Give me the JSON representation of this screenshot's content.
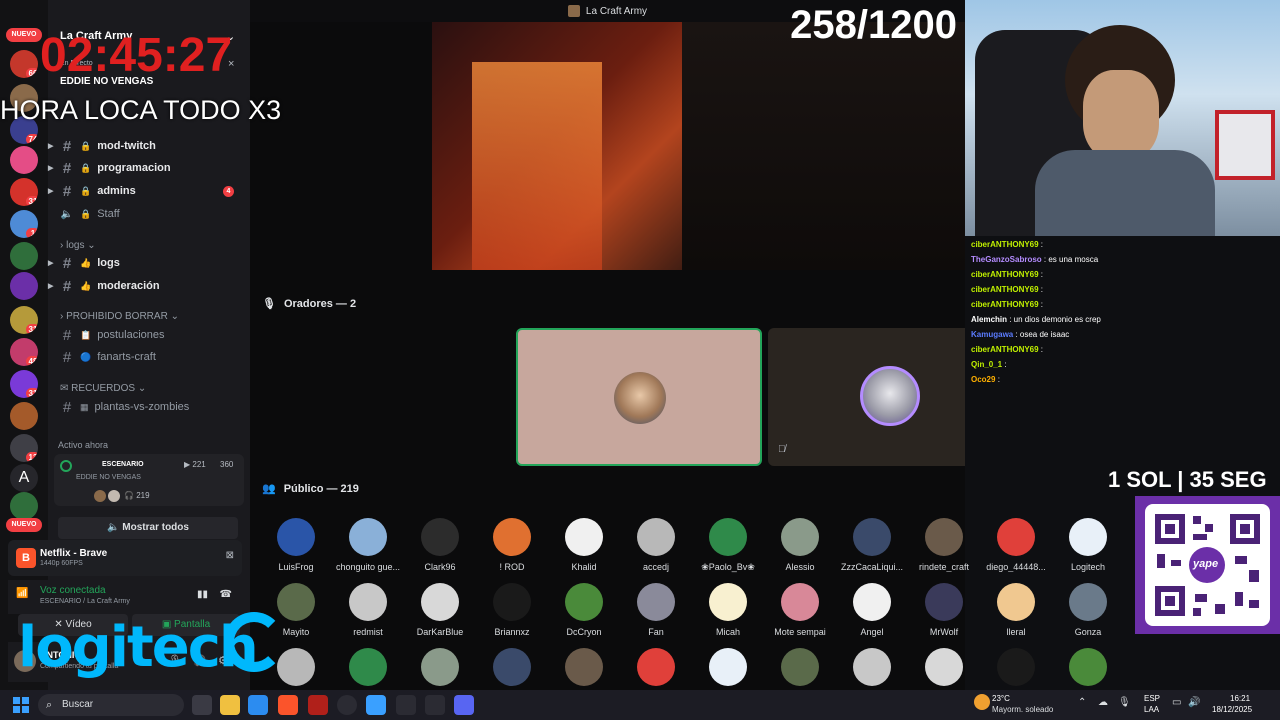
{
  "window": {
    "title": "La Craft Army"
  },
  "overlay": {
    "timer": "02:45:27",
    "counter": "258/1200",
    "hora_loca": "HORA LOCA TODO X3",
    "sol_seg": "1 SOL | 35 SEG",
    "logo_text": "logitech",
    "yape": "yape"
  },
  "rail": {
    "new_label": "NUEVO",
    "badges": [
      "66",
      "74",
      "31",
      "1",
      "31",
      "48",
      "31",
      "13"
    ]
  },
  "server": {
    "name": "La Craft Army",
    "event_label": "En Directo",
    "event_title": "EDDIE NO VENGAS",
    "channels": [
      {
        "name": "mod-twitch"
      },
      {
        "name": "programacion"
      },
      {
        "name": "admins",
        "badge": "4"
      },
      {
        "name": "Staff"
      }
    ],
    "cat_logs": "logs",
    "log_channels": [
      {
        "name": "logs"
      },
      {
        "name": "moderación"
      }
    ],
    "cat_borrar": "PROHIBIDO BORRAR",
    "borrar_channels": [
      {
        "name": "postulaciones"
      },
      {
        "name": "fanarts-craft"
      }
    ],
    "cat_recuerdos": "RECUERDOS",
    "recuerdos_channels": [
      {
        "name": "plantas-vs-zombies"
      }
    ],
    "active_now": "Activo ahora",
    "stage_label": "ESCENARIO",
    "stage_sub": "EDDIE NO VENGAS",
    "stage_video": "221",
    "stage_people": "360",
    "stage_listeners": "219",
    "show_all": "Mostrar todos"
  },
  "activity": {
    "title": "Netflix - Brave",
    "sub": "1440p 60FPS"
  },
  "voice": {
    "status": "Voz conectada",
    "location": "ESCENARIO / La Craft Army",
    "video": "Vídeo",
    "screen": "Pantalla"
  },
  "user": {
    "name": "ANTONIO",
    "status": "Compartiendo tu pantalla"
  },
  "stage": {
    "speakers_title": "Oradores — 2",
    "audience_title": "Público — 219",
    "audience_row1": [
      "LuisFrog",
      "chonguito gue...",
      "Clark96",
      "! ROD",
      "Khalid",
      "accedj",
      "❀Paolo_Bv❀",
      "Alessio",
      "ZzzCacaLiqui...",
      "rindete_craft",
      "diego_44448...",
      "Logitech"
    ],
    "audience_row2": [
      "Mayito",
      "redmist",
      "DarKarBlue",
      "Briannxz",
      "DcCryon",
      "Fan",
      "Micah",
      "Mote sempai",
      "Angel",
      "MrWolf",
      "lleral",
      "Gonza"
    ]
  },
  "chat": {
    "messages": [
      {
        "user": "ciberANTHONY69",
        "text": ":",
        "color": "#c0f000"
      },
      {
        "user": "TheGanzoSabroso",
        "text": ": es una mosca",
        "color": "#b48cff"
      },
      {
        "user": "ciberANTHONY69",
        "text": ":",
        "color": "#c0f000"
      },
      {
        "user": "ciberANTHONY69",
        "text": ":",
        "color": "#c0f000"
      },
      {
        "user": "ciberANTHONY69",
        "text": ":",
        "color": "#c0f000"
      },
      {
        "user": "Alemchin",
        "text": ": un dios demonio es crep",
        "color": "#ffffff"
      },
      {
        "user": "Kamugawa",
        "text": ": osea de isaac",
        "color": "#5b7cff"
      },
      {
        "user": "ciberANTHONY69",
        "text": ":",
        "color": "#c0f000"
      },
      {
        "user": "Qin_0_1",
        "text": ":",
        "color": "#c0f000"
      },
      {
        "user": "Oco29",
        "text": ":",
        "color": "#ffb000"
      }
    ]
  },
  "taskbar": {
    "search": "Buscar",
    "weather_temp": "23°C",
    "weather_desc": "Mayorm. soleado",
    "lang": "ESP",
    "lang2": "LAA",
    "time": "16:21",
    "date": "18/12/2025"
  },
  "colors": {
    "accent": "#5865f2",
    "green": "#23a55a",
    "red": "#f23f43"
  }
}
